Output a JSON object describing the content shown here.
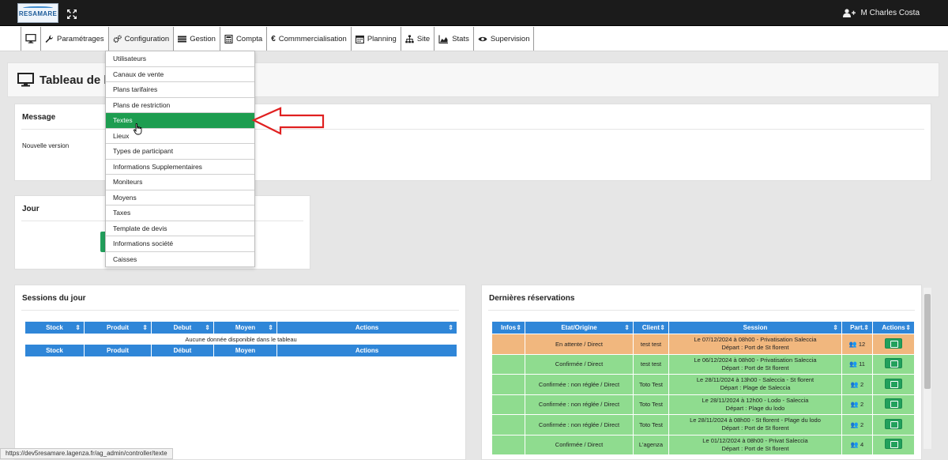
{
  "topbar": {
    "logo_text": "RESAMARE",
    "user_name": "M Charles Costa"
  },
  "menu": [
    {
      "label": "",
      "icon": "monitor-icon"
    },
    {
      "label": "Paramétrages",
      "icon": "wrench-icon"
    },
    {
      "label": "Configuration",
      "icon": "cogs-icon"
    },
    {
      "label": "Gestion",
      "icon": "list-icon"
    },
    {
      "label": "Compta",
      "icon": "calculator-icon"
    },
    {
      "label": "Commmercialisation",
      "icon": "euro-icon"
    },
    {
      "label": "Planning",
      "icon": "calendar-icon"
    },
    {
      "label": "Site",
      "icon": "sitemap-icon"
    },
    {
      "label": "Stats",
      "icon": "chart-icon"
    },
    {
      "label": "Supervision",
      "icon": "eye-icon"
    }
  ],
  "page_title": "Tableau de bo",
  "dropdown": [
    "Utilisateurs",
    "Canaux de vente",
    "Plans tarifaires",
    "Plans de restriction",
    "Textes",
    "Lieux",
    "Types de participant",
    "Informations Supplementaires",
    "Moniteurs",
    "Moyens",
    "Taxes",
    "Template de devis",
    "Informations société",
    "Caisses"
  ],
  "message_card": {
    "title": "Message",
    "text": "Nouvelle version"
  },
  "jour_card": {
    "title": "Jour"
  },
  "sessions": {
    "title": "Sessions du jour",
    "columns": [
      "Stock",
      "Produit",
      "Debut",
      "Moyen",
      "Actions"
    ],
    "empty_text": "Aucune donnée disponible dans le tableau",
    "footer_columns": [
      "Stock",
      "Produit",
      "Début",
      "Moyen",
      "Actions"
    ]
  },
  "reservations": {
    "title": "Dernières réservations",
    "columns": [
      "Infos",
      "Etat/Origine",
      "Client",
      "Session",
      "Part.",
      "Actions"
    ],
    "rows": [
      {
        "status": "orange",
        "etat": "En attente / Direct",
        "client": "test test",
        "session1": "Le 07/12/2024 à 08h00 - Privatisation Saleccia",
        "session2": "Départ : Port de St florent",
        "part": "12"
      },
      {
        "status": "green",
        "etat": "Confirmée / Direct",
        "client": "test test",
        "session1": "Le 06/12/2024 à 08h00 - Privatisation Saleccia",
        "session2": "Départ : Port de St florent",
        "part": "11"
      },
      {
        "status": "green",
        "etat": "Confirmée : non réglée / Direct",
        "client": "Toto Test",
        "session1": "Le 28/11/2024 à 13h00 - Saleccia - St florent",
        "session2": "Départ : Plage de Saleccia",
        "part": "2"
      },
      {
        "status": "green",
        "etat": "Confirmée : non réglée / Direct",
        "client": "Toto Test",
        "session1": "Le 28/11/2024 à 12h00 - Lodo - Saleccia",
        "session2": "Départ : Plage du lodo",
        "part": "2"
      },
      {
        "status": "green",
        "etat": "Confirmée : non réglée / Direct",
        "client": "Toto Test",
        "session1": "Le 28/11/2024 à 08h00 - St florent - Plage du lodo",
        "session2": "Départ : Port de St florent",
        "part": "2"
      },
      {
        "status": "green",
        "etat": "Confirmée / Direct",
        "client": "L'agenza",
        "session1": "Le 01/12/2024 à 08h00 - Privat Saleccia",
        "session2": "Départ : Port de St florent",
        "part": "4"
      }
    ]
  },
  "status_url": "https://dev5resamare.lagenza.fr/ag_admin/controller/texte",
  "colors": {
    "accent_blue": "#2f86d8",
    "highlight_green": "#1d9d50",
    "row_orange": "#f1b77e",
    "row_green": "#8fdc8f",
    "arrow_red": "#e02020"
  }
}
